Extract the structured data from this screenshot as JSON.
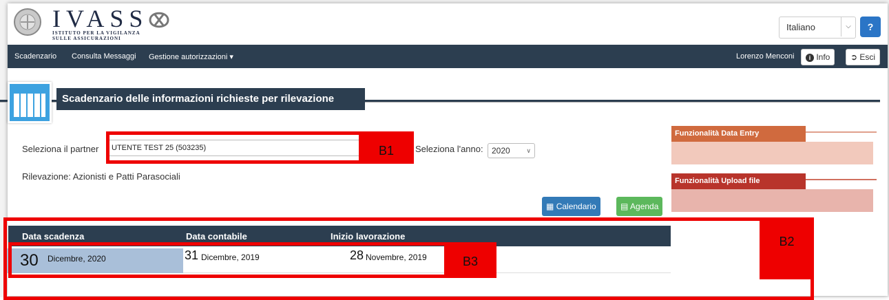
{
  "header": {
    "logo_main": "IVASS",
    "logo_sub1": "ISTITUTO PER LA VIGILANZA",
    "logo_sub2": "SULLE ASSICURAZIONI",
    "language": "Italiano",
    "help_label": "?"
  },
  "nav": {
    "items": [
      "Scadenzario",
      "Consulta Messaggi",
      "Gestione autorizzazioni"
    ],
    "user": "Lorenzo Menconi",
    "info_label": "Info",
    "exit_label": "Esci"
  },
  "page": {
    "title": "Scadenzario delle informazioni richieste per rilevazione"
  },
  "form": {
    "partner_label": "Seleziona il partner",
    "partner_value": "UTENTE TEST 25 (503235)",
    "year_label": "Seleziona l'anno:",
    "year_value": "2020",
    "rilevazione": "Rilevazione: Azionisti e Patti Parasociali"
  },
  "buttons": {
    "calendario": "Calendario",
    "agenda": "Agenda"
  },
  "panels": {
    "data_entry": "Funzionalità Data Entry",
    "upload": "Funzionalità Upload file"
  },
  "table": {
    "headers": [
      "Data scadenza",
      "Data contabile",
      "Inizio lavorazione"
    ],
    "row": {
      "scadenza_day": "30",
      "scadenza_rest": "Dicembre, 2020",
      "contabile_day": "31",
      "contabile_rest": "Dicembre, 2019",
      "lavorazione_day": "28",
      "lavorazione_rest": "Novembre, 2019"
    }
  },
  "annotations": {
    "b1": "B1",
    "b2": "B2",
    "b3": "B3"
  },
  "colors": {
    "navy": "#2c3e50",
    "annotation_red": "#ee0000",
    "btn_blue": "#337ab7",
    "btn_green": "#5cb85c",
    "panel1": "#d06a3e",
    "panel2": "#b8342b",
    "panel_body": "#e8b4ac"
  }
}
